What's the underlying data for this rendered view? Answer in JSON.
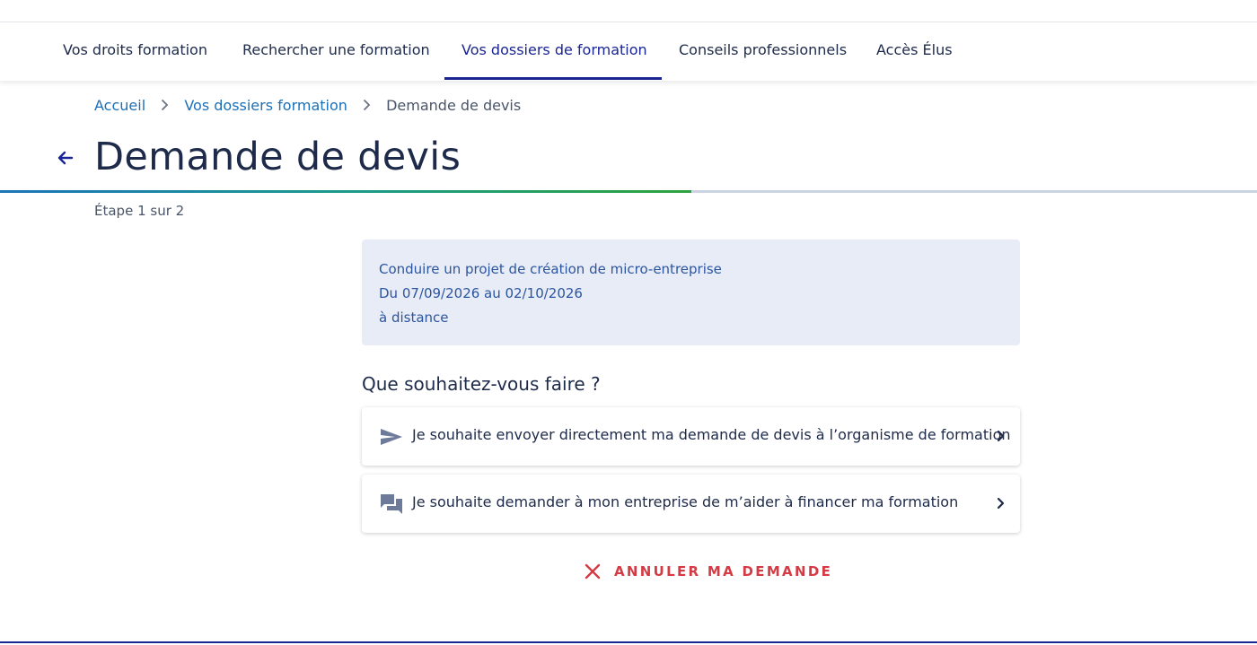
{
  "nav": {
    "items": [
      {
        "label": "Vos droits formation"
      },
      {
        "label": "Rechercher une formation"
      },
      {
        "label": "Vos dossiers de formation",
        "active": true
      },
      {
        "label": "Conseils professionnels"
      },
      {
        "label": "Accès Élus"
      }
    ]
  },
  "breadcrumb": {
    "home": "Accueil",
    "parent": "Vos dossiers formation",
    "current": "Demande de devis"
  },
  "page": {
    "title": "Demande de devis",
    "step_label": "Étape 1 sur 2",
    "progress": 0.55
  },
  "training": {
    "name": "Conduire un projet de création de micro-entreprise",
    "dates": "Du 07/09/2026 au 02/10/2026",
    "mode": "à distance"
  },
  "question": "Que souhaitez-vous faire ?",
  "options": [
    {
      "label": "Je souhaite envoyer directement ma demande de devis à l’organisme de formation",
      "icon": "send-icon"
    },
    {
      "label": "Je souhaite demander à mon entreprise de m’aider à financer ma formation",
      "icon": "chat-icon"
    }
  ],
  "cancel_label": "ANNULER MA DEMANDE",
  "colors": {
    "primary": "#1a2594",
    "link": "#1c6fb5",
    "danger": "#d53b44",
    "card_bg": "#e8ecf6"
  }
}
